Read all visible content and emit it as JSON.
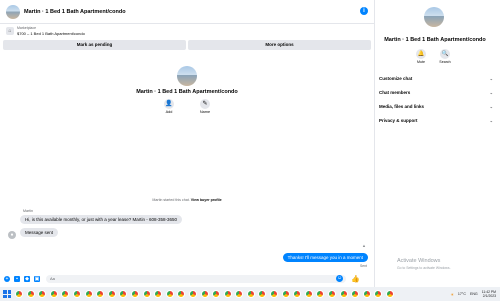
{
  "header": {
    "title": "Martin · 1 Bed 1 Bath Apartment/condo",
    "info_icon": "info-icon"
  },
  "listing": {
    "kicker": "Marketplace",
    "summary": "$700 – 1 Bed 1 Bath Apartment/condo",
    "icon": "marketplace-icon"
  },
  "actions": {
    "mark_pending": "Mark as pending",
    "more_options": "More options"
  },
  "profile": {
    "name": "Martin · 1 Bed 1 Bath Apartment/condo",
    "add_label": "Add",
    "name_label": "Name"
  },
  "conversation": {
    "started_text": "Martin started this chat.",
    "view_profile": "View buyer profile",
    "sender": "Martin",
    "messages_in": [
      "Hi, is this available monthly, or just with a year lease? Martin - 608-358-3650",
      "Message sent"
    ],
    "message_out": "Thanks! I'll message you in a moment",
    "status": "Sent"
  },
  "composer": {
    "placeholder": "Aa"
  },
  "details": {
    "name": "Martin · 1 Bed 1 Bath Apartment/condo",
    "mute_label": "Mute",
    "search_label": "Search",
    "sections": [
      "Customize chat",
      "Chat members",
      "Media, files and links",
      "Privacy & support"
    ]
  },
  "watermark": {
    "title": "Activate Windows",
    "subtitle": "Go to Settings to activate Windows."
  },
  "taskbar": {
    "temperature": "17°C",
    "language": "ENG",
    "time": "11:42 PM",
    "date": "2/1/2023"
  },
  "colors": {
    "accent": "#0084ff",
    "bubble_in": "#e4e6eb"
  }
}
